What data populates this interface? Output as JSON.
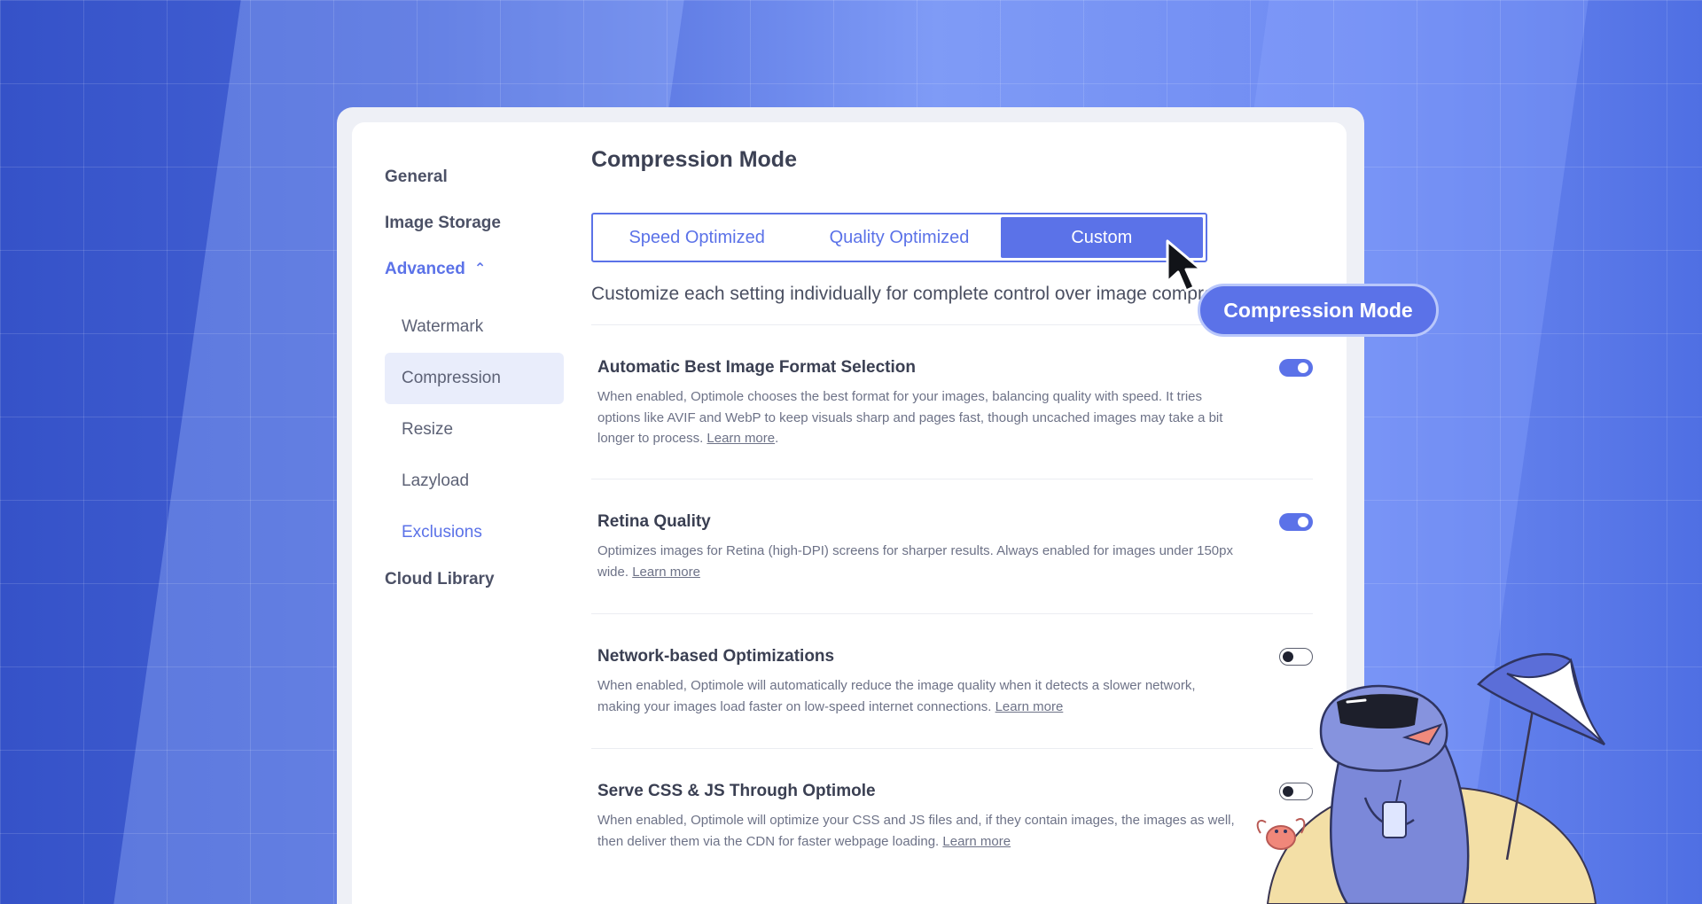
{
  "sidebar": {
    "general": "General",
    "image_storage": "Image Storage",
    "advanced": "Advanced",
    "advanced_items": [
      "Watermark",
      "Compression",
      "Resize",
      "Lazyload",
      "Exclusions"
    ],
    "cloud_library": "Cloud Library",
    "selected_item": "Compression"
  },
  "main": {
    "title": "Compression Mode",
    "segments": [
      "Speed Optimized",
      "Quality Optimized",
      "Custom"
    ],
    "selected_segment": "Custom",
    "mode_description": "Customize each setting individually for complete control over image compression.",
    "settings": [
      {
        "title": "Automatic Best Image Format Selection",
        "description": "When enabled, Optimole chooses the best format for your images, balancing quality with speed. It tries options like AVIF and WebP to keep visuals sharp and pages fast, though uncached images may take a bit longer to process.",
        "link": "Learn more",
        "suffix": ".",
        "enabled": true
      },
      {
        "title": "Retina Quality",
        "description": "Optimizes images for Retina (high-DPI) screens for sharper results. Always enabled for images under 150px wide.",
        "link": "Learn more",
        "suffix": "",
        "enabled": true
      },
      {
        "title": "Network-based Optimizations",
        "description": "When enabled, Optimole will automatically reduce the image quality when it detects a slower network, making your images load faster on low-speed internet connections.",
        "link": "Learn more",
        "suffix": "",
        "enabled": false
      },
      {
        "title": "Serve CSS & JS Through Optimole",
        "description": "When enabled, Optimole will optimize your CSS and JS files and, if they contain images, the images as well, then deliver them via the CDN for faster webpage loading.",
        "link": "Learn more",
        "suffix": "",
        "enabled": false
      }
    ]
  },
  "callout": {
    "label": "Compression Mode"
  },
  "icons": {
    "chevron": "chevron-up-icon",
    "cursor": "mouse-pointer-icon",
    "mascot": "mascot-illustration"
  },
  "colors": {
    "accent": "#5b72e8",
    "background": "#5272e0",
    "card": "#ffffff"
  }
}
